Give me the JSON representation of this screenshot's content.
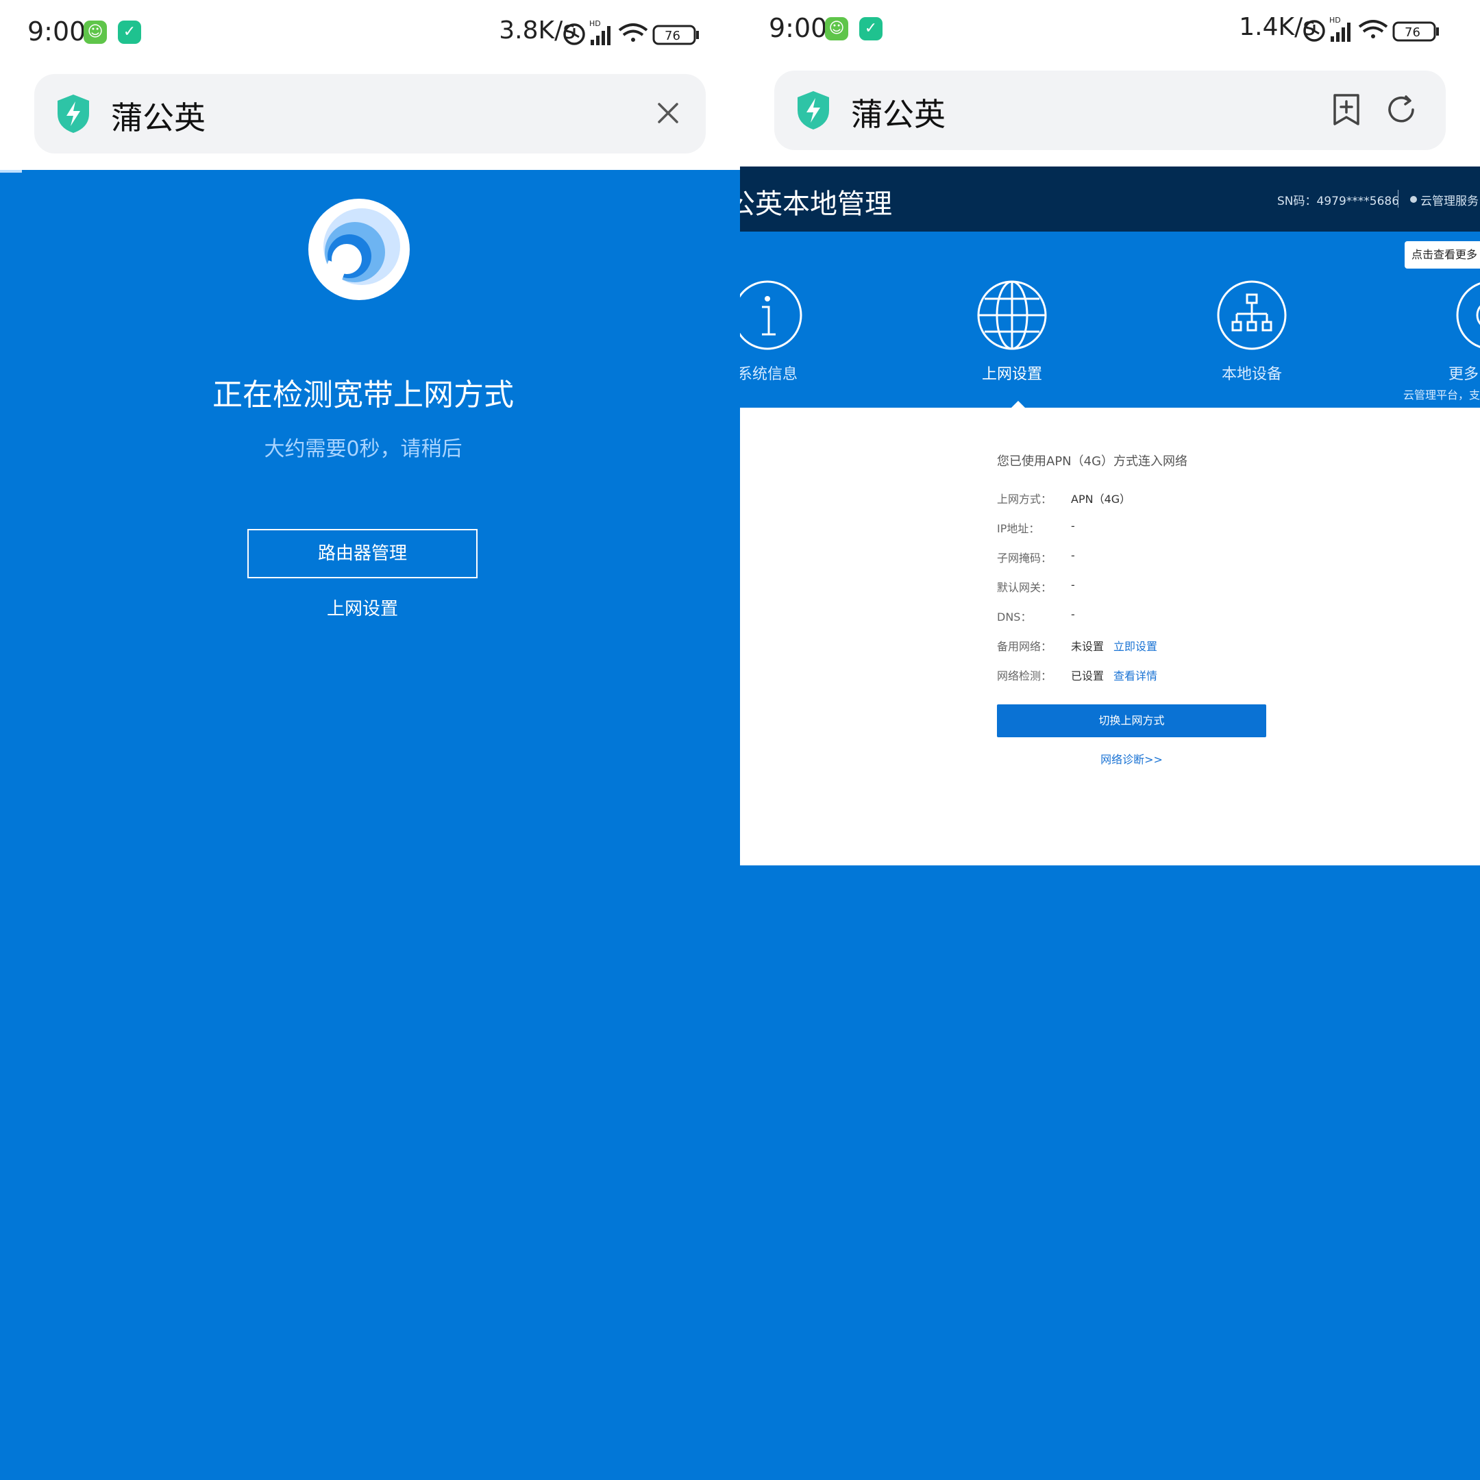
{
  "colors": {
    "page_blue": "#0277d7",
    "header_navy": "#022b52",
    "link_blue": "#1a73d4",
    "button_blue": "#0a72d4",
    "shield_teal": "#2ec4a6"
  },
  "left": {
    "statusbar": {
      "time": "9:00",
      "speed": "3.8K/s",
      "battery": "76",
      "network_label": "HD"
    },
    "urlbar": {
      "title": "蒲公英",
      "icon": "shield-bolt-icon",
      "action_icon": "close-icon"
    },
    "detect": {
      "title": "正在检测宽带上网方式",
      "subtitle": "大约需要0秒，请稍后",
      "router_button": "路由器管理",
      "settings_link": "上网设置"
    }
  },
  "right": {
    "statusbar": {
      "time": "9:00",
      "speed": "1.4K/s",
      "battery": "76",
      "network_label": "HD"
    },
    "urlbar": {
      "title": "蒲公英",
      "icon": "shield-bolt-icon",
      "bookmark_icon": "bookmark-add-icon",
      "refresh_icon": "refresh-icon"
    },
    "app": {
      "title": "公英本地管理",
      "sn": "SN码：4979****5686",
      "cloud": "云管理服务",
      "tooltip": "点击查看更多"
    },
    "nav": [
      {
        "label": "系统信息",
        "icon": "info-icon"
      },
      {
        "label": "上网设置",
        "icon": "globe-icon"
      },
      {
        "label": "本地设备",
        "icon": "network-tree-icon"
      },
      {
        "label": "更多",
        "icon": "gear-icon"
      }
    ],
    "nav_sub": "云管理平台，支",
    "info": {
      "title": "您已使用APN（4G）方式连入网络",
      "rows": [
        {
          "label": "上网方式：",
          "value": "APN（4G）"
        },
        {
          "label": "IP地址：",
          "value": "-"
        },
        {
          "label": "子网掩码：",
          "value": "-"
        },
        {
          "label": "默认网关：",
          "value": "-"
        },
        {
          "label": "DNS：",
          "value": "-"
        },
        {
          "label": "备用网络：",
          "value": "未设置",
          "link": "立即设置"
        },
        {
          "label": "网络检测：",
          "value": "已设置",
          "link": "查看详情"
        }
      ],
      "switch_button": "切换上网方式",
      "diagnose_link": "网络诊断>>"
    }
  }
}
